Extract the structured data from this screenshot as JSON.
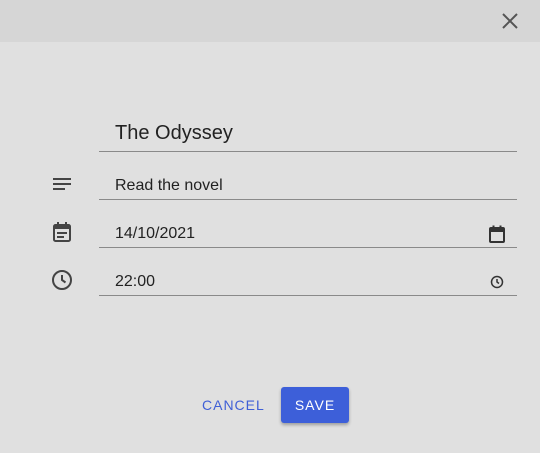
{
  "dialog": {
    "close_icon": "close-icon"
  },
  "form": {
    "title": {
      "value": "The Odyssey"
    },
    "description": {
      "icon": "notes-icon",
      "value": "Read the novel"
    },
    "date": {
      "icon": "event-icon",
      "value": "14/10/2021",
      "picker_icon": "calendar-icon"
    },
    "time": {
      "icon": "clock-icon",
      "value": "22:00",
      "picker_icon": "clock-icon"
    }
  },
  "actions": {
    "cancel_label": "CANCEL",
    "save_label": "SAVE"
  },
  "colors": {
    "background": "#e0e0e0",
    "topbar": "#d6d6d6",
    "accent": "#3d5fd9",
    "icon": "#444444"
  }
}
